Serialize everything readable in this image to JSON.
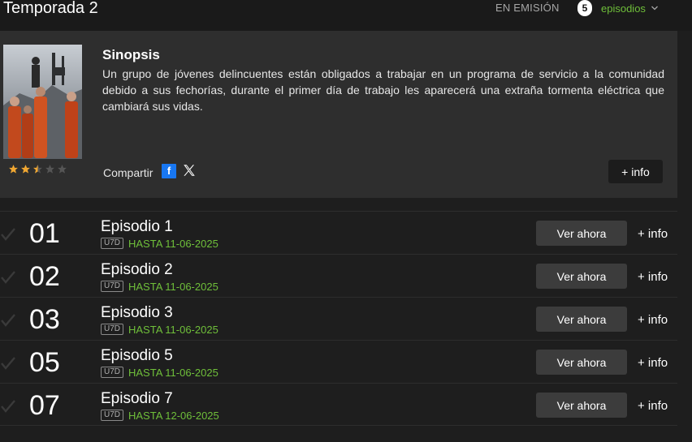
{
  "header": {
    "season_title": "Temporada 2",
    "on_air": "EN EMISIÓN",
    "episode_count": "5",
    "episodes_label": "episodios"
  },
  "synopsis": {
    "title": "Sinopsis",
    "text": "Un grupo de jóvenes delincuentes están obligados a trabajar en un programa de servicio a la comunidad debido a sus fechorías, durante el primer día de trabajo les aparecerá una extraña tormenta eléctrica que cambiará sus vidas.",
    "rating_stars": 2.5,
    "rating_max": 5,
    "share_label": "Compartir",
    "more_info_label": "+ info"
  },
  "episodes": [
    {
      "number": "01",
      "title": "Episodio 1",
      "badge": "U7D",
      "until": "HASTA 11-06-2025",
      "watch_label": "Ver ahora",
      "info_label": "+ info"
    },
    {
      "number": "02",
      "title": "Episodio 2",
      "badge": "U7D",
      "until": "HASTA 11-06-2025",
      "watch_label": "Ver ahora",
      "info_label": "+ info"
    },
    {
      "number": "03",
      "title": "Episodio 3",
      "badge": "U7D",
      "until": "HASTA 11-06-2025",
      "watch_label": "Ver ahora",
      "info_label": "+ info"
    },
    {
      "number": "05",
      "title": "Episodio 5",
      "badge": "U7D",
      "until": "HASTA 11-06-2025",
      "watch_label": "Ver ahora",
      "info_label": "+ info"
    },
    {
      "number": "07",
      "title": "Episodio 7",
      "badge": "U7D",
      "until": "HASTA 12-06-2025",
      "watch_label": "Ver ahora",
      "info_label": "+ info"
    }
  ],
  "colors": {
    "accent_green": "#6fbf3a",
    "facebook_blue": "#1877f2",
    "star_gold": "#f0a732"
  }
}
